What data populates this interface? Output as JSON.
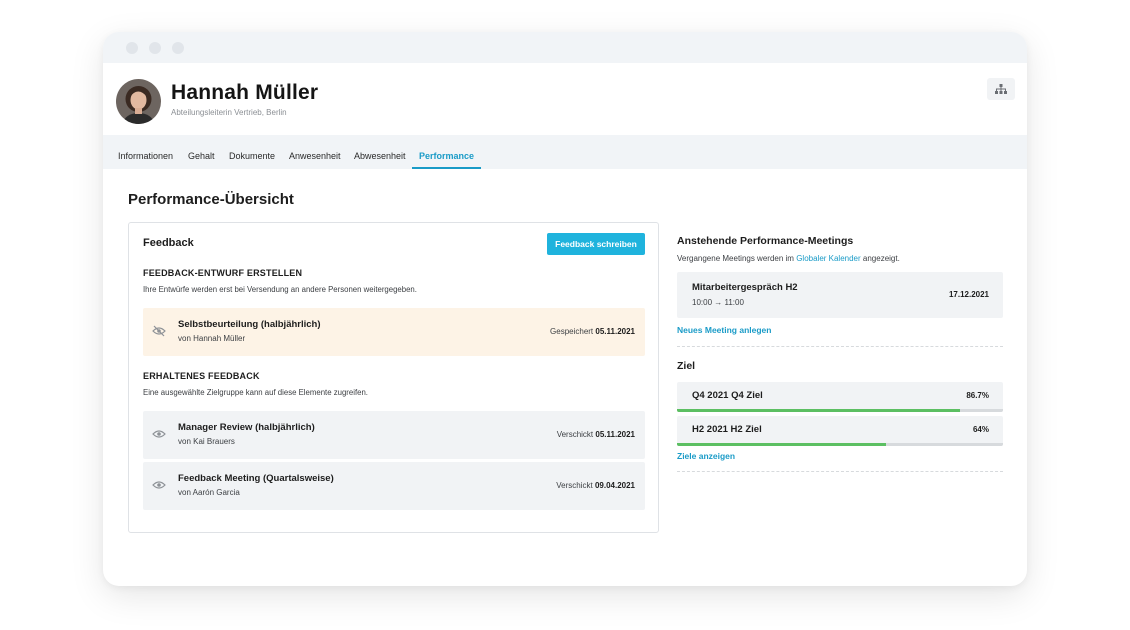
{
  "profile": {
    "name": "Hannah Müller",
    "role": "Abteilungsleiterin Vertrieb, Berlin",
    "org_chart_icon": "org-chart-icon"
  },
  "tabs": [
    {
      "label": "Informationen",
      "active": false
    },
    {
      "label": "Gehalt",
      "active": false
    },
    {
      "label": "Dokumente",
      "active": false
    },
    {
      "label": "Anwesenheit",
      "active": false
    },
    {
      "label": "Abwesenheit",
      "active": false
    },
    {
      "label": "Performance",
      "active": true
    }
  ],
  "main": {
    "title": "Performance-Übersicht",
    "feedback": {
      "title": "Feedback",
      "write_button": "Feedback schreiben",
      "draft": {
        "heading": "FEEDBACK-ENTWURF ERSTELLEN",
        "description": "Ihre Entwürfe werden erst bei Versendung an andere Personen weitergegeben.",
        "items": [
          {
            "title": "Selbstbeurteilung (halbjährlich)",
            "author": "von Hannah Müller",
            "status_label": "Gespeichert",
            "status_date": "05.11.2021",
            "icon": "eye-off-icon"
          }
        ]
      },
      "received": {
        "heading": "ERHALTENES FEEDBACK",
        "description": "Eine ausgewählte Zielgruppe kann auf diese Elemente zugreifen.",
        "items": [
          {
            "title": "Manager Review (halbjährlich)",
            "author": "von Kai Brauers",
            "status_label": "Verschickt",
            "status_date": "05.11.2021",
            "icon": "eye-icon"
          },
          {
            "title": "Feedback Meeting (Quartalsweise)",
            "author": "von Aarón Garcia",
            "status_label": "Verschickt",
            "status_date": "09.04.2021",
            "icon": "eye-icon"
          }
        ]
      }
    }
  },
  "meetings": {
    "title": "Anstehende Performance-Meetings",
    "note_before": "Vergangene Meetings werden im ",
    "note_link": "Globaler Kalender",
    "note_after": " angezeigt.",
    "items": [
      {
        "title": "Mitarbeitergespräch H2",
        "time": "10:00 → 11:00",
        "date": "17.12.2021"
      }
    ],
    "new_meeting_link": "Neues Meeting anlegen"
  },
  "goals": {
    "title": "Ziel",
    "items": [
      {
        "label": "Q4 2021 Q4 Ziel",
        "percent_label": "86.7%",
        "progress": 0.867
      },
      {
        "label": "H2 2021 H2 Ziel",
        "percent_label": "64%",
        "progress": 0.64
      }
    ],
    "show_goals_link": "Ziele anzeigen"
  },
  "colors": {
    "accent": "#1a9bc7",
    "button": "#1fb3dd",
    "progress": "#5cbf62",
    "draft_bg": "#fdf3e6"
  }
}
